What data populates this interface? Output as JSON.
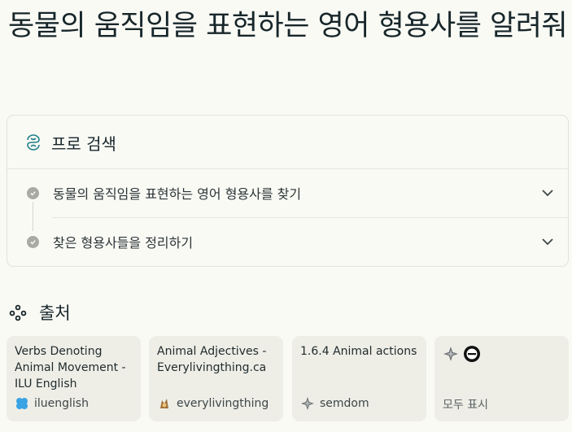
{
  "title": "동물의 움직임을 표현하는 영어 형용사를 알려줘",
  "pro_search": {
    "label": "프로 검색",
    "icon": "pro-search-icon",
    "steps": [
      {
        "label": "동물의 움직임을 표현하는 영어 형용사를 찾기",
        "icon": "check-circle-icon",
        "expand_icon": "chevron-down-icon"
      },
      {
        "label": "찾은 형용사들을 정리하기",
        "icon": "check-circle-icon",
        "expand_icon": "chevron-down-icon"
      }
    ]
  },
  "sources": {
    "label": "출처",
    "icon": "sources-icon",
    "items": [
      {
        "title": "Verbs Denoting Animal Movement - ILU English",
        "domain": "iluenglish",
        "favicon": "iluenglish-favicon"
      },
      {
        "title": "Animal Adjectives - Everylivingthing.ca",
        "domain": "everylivingthing",
        "favicon": "everylivingthing-favicon"
      },
      {
        "title": "1.6.4 Animal actions",
        "domain": "semdom",
        "favicon": "semdom-favicon"
      }
    ],
    "show_all_label": "모두 표시"
  },
  "colors": {
    "background": "#fafaf5",
    "card": "#eeeee7",
    "text": "#17262a",
    "muted": "#a9aaa5"
  }
}
